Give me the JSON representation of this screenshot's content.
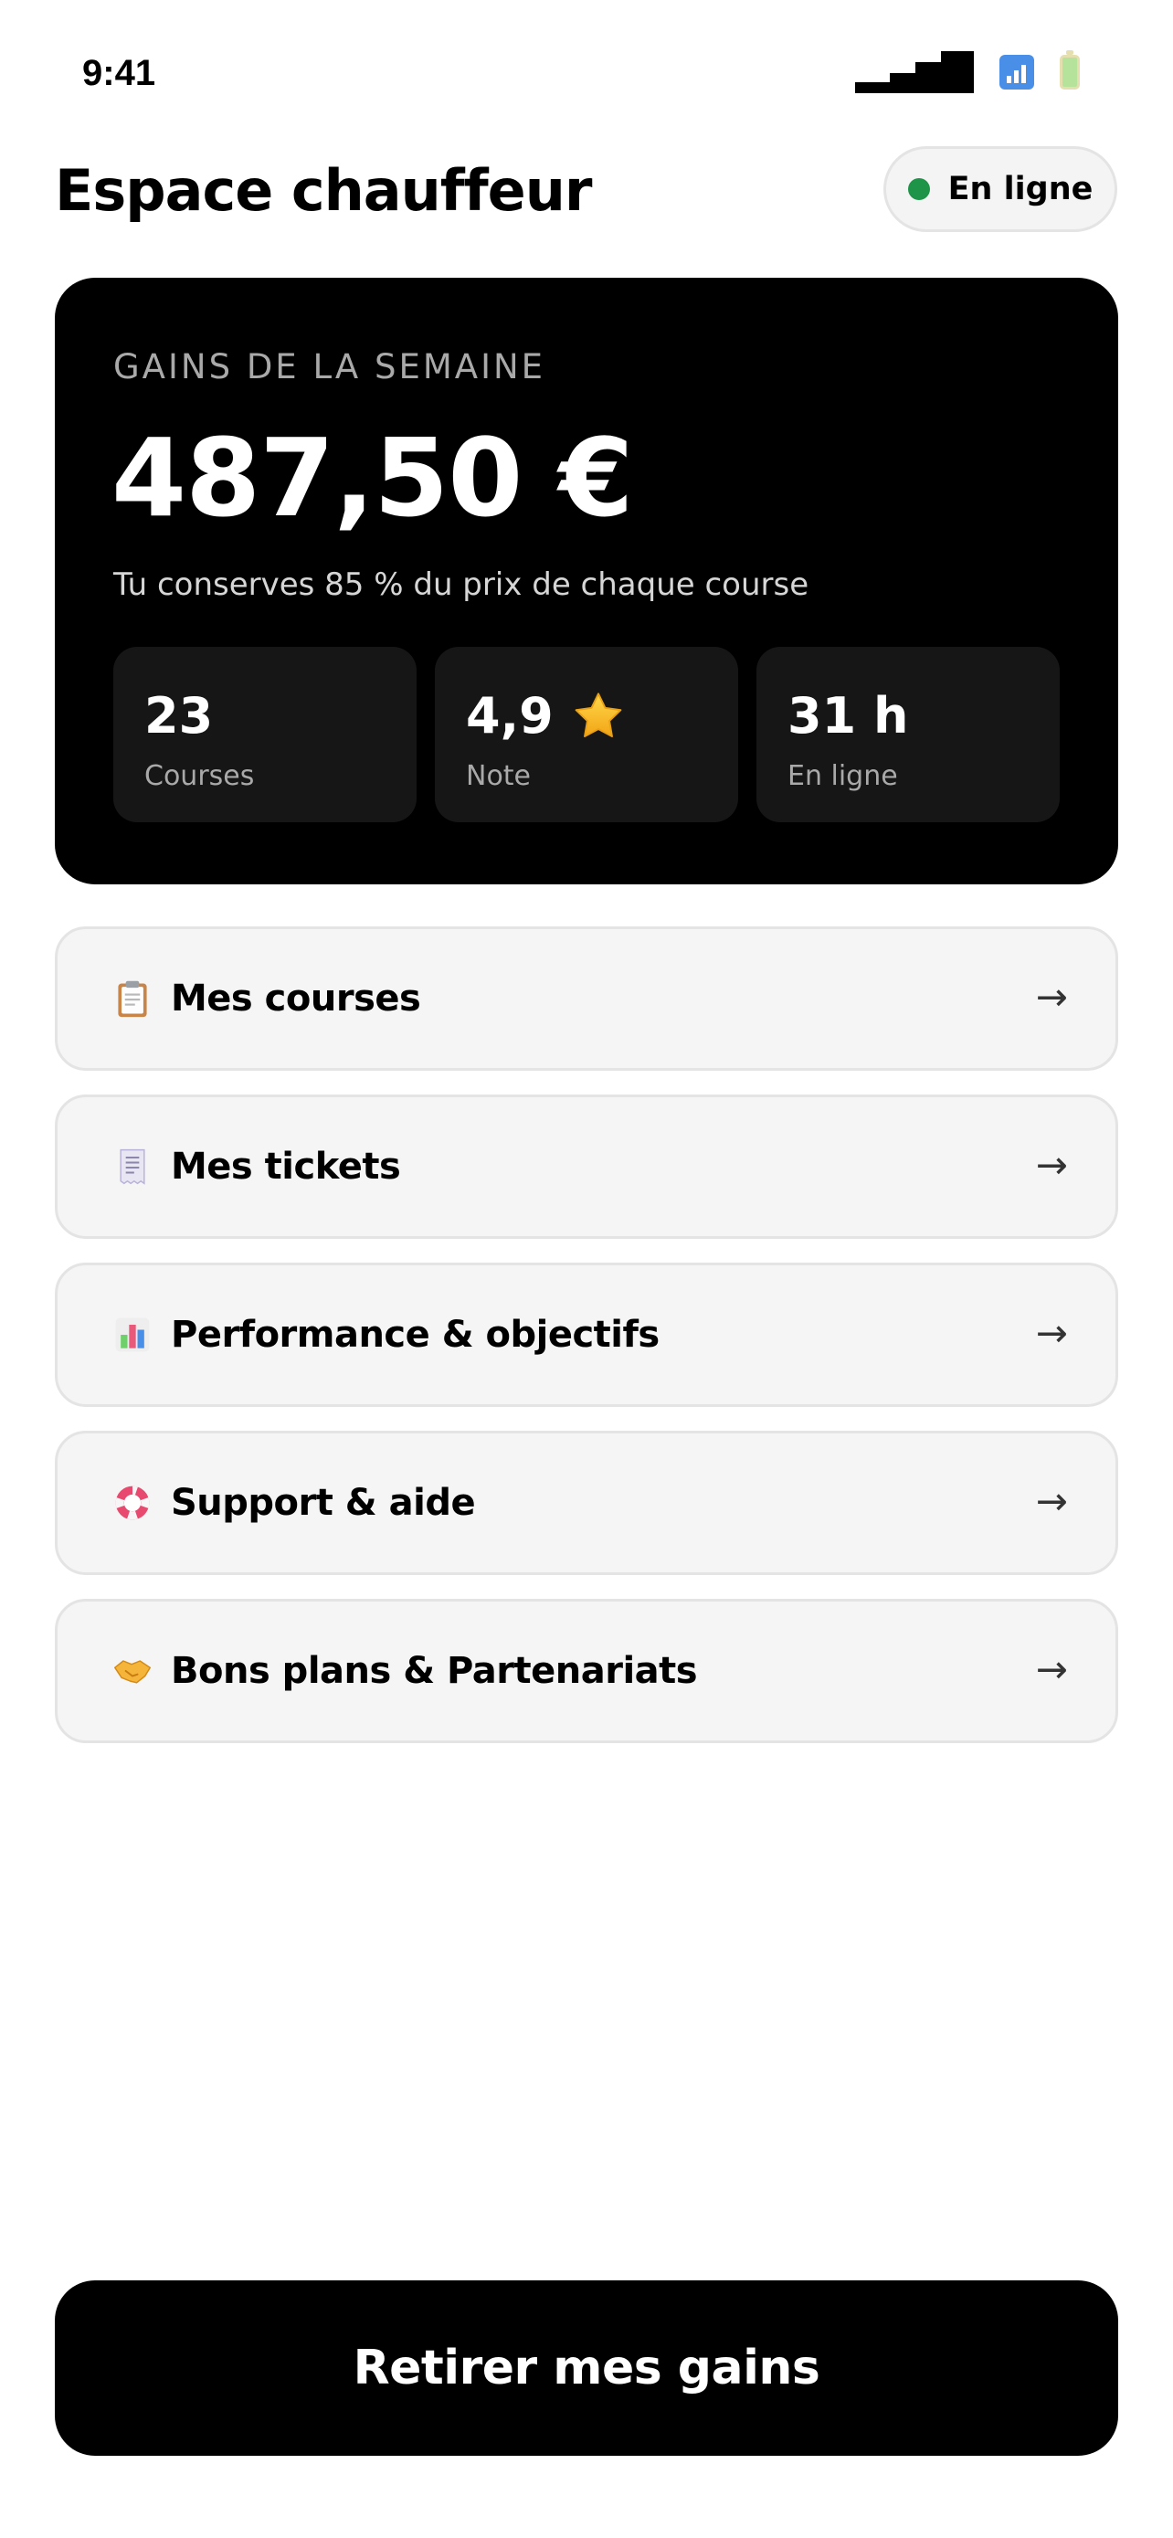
{
  "status_bar": {
    "time": "9:41",
    "icons": [
      "signal-icon",
      "wifi-icon",
      "battery-icon"
    ]
  },
  "header": {
    "title": "Espace chauffeur",
    "status_label": "En ligne",
    "status_color": "#1e9448"
  },
  "earnings": {
    "label": "GAINS DE LA SEMAINE",
    "amount": "487,50 €",
    "note": "Tu conserves 85 % du prix de chaque course",
    "stats": [
      {
        "value": "23",
        "label": "Courses",
        "icon": null
      },
      {
        "value": "4,9",
        "label": "Note",
        "icon": "star-icon"
      },
      {
        "value": "31 h",
        "label": "En ligne",
        "icon": null
      }
    ]
  },
  "menu": [
    {
      "label": "Mes courses",
      "icon": "clipboard-icon",
      "arrow": "→"
    },
    {
      "label": "Mes tickets",
      "icon": "receipt-icon",
      "arrow": "→"
    },
    {
      "label": "Performance & objectifs",
      "icon": "bar-chart-icon",
      "arrow": "→"
    },
    {
      "label": "Support & aide",
      "icon": "lifebuoy-icon",
      "arrow": "→"
    },
    {
      "label": "Bons plans & Partenariats",
      "icon": "handshake-icon",
      "arrow": "→"
    }
  ],
  "actions": {
    "withdraw_label": "Retirer mes gains"
  },
  "colors": {
    "card_bg": "#000000",
    "stat_bg": "#161616",
    "menu_bg": "#f5f5f5",
    "online_green": "#1e9448"
  }
}
